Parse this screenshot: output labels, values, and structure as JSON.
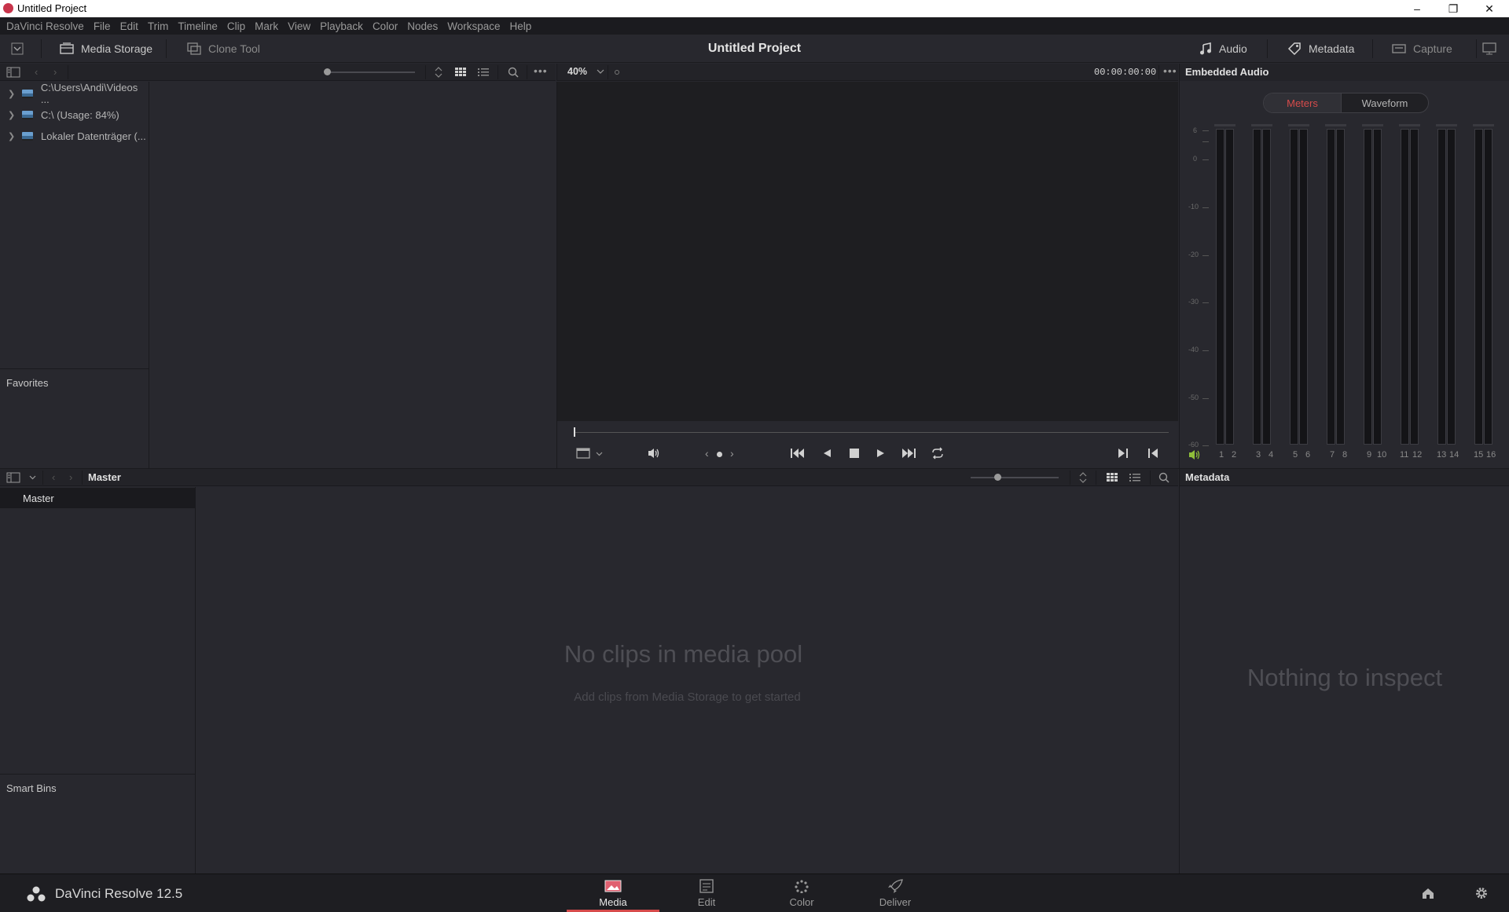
{
  "window": {
    "title": "Untitled Project"
  },
  "menu": [
    "DaVinci Resolve",
    "File",
    "Edit",
    "Trim",
    "Timeline",
    "Clip",
    "Mark",
    "View",
    "Playback",
    "Color",
    "Nodes",
    "Workspace",
    "Help"
  ],
  "toolbar": {
    "media_storage": "Media Storage",
    "clone_tool": "Clone Tool",
    "project_title": "Untitled Project",
    "audio": "Audio",
    "metadata": "Metadata",
    "capture": "Capture"
  },
  "media_storage": {
    "locations": [
      "C:\\Users\\Andi\\Videos ...",
      "C:\\ (Usage: 84%)",
      "Lokaler Datenträger (..."
    ],
    "favorites_label": "Favorites"
  },
  "viewer": {
    "zoom": "40%",
    "timecode": "00:00:00:00"
  },
  "audio_panel": {
    "title": "Embedded Audio",
    "tabs": [
      "Meters",
      "Waveform"
    ],
    "active_tab": "Meters",
    "scale": [
      "6",
      "0",
      "-10",
      "-20",
      "-30",
      "-40",
      "-50",
      "-60"
    ],
    "channel_labels": [
      "1",
      "2",
      "3",
      "4",
      "5",
      "6",
      "7",
      "8",
      "9",
      "10",
      "11",
      "12",
      "13",
      "14",
      "15",
      "16"
    ]
  },
  "media_pool": {
    "breadcrumb": "Master",
    "bins": [
      "Master"
    ],
    "smart_bins_label": "Smart Bins",
    "empty_title": "No clips in media pool",
    "empty_hint": "Add clips from Media Storage to get started"
  },
  "metadata_panel": {
    "title": "Metadata",
    "empty": "Nothing to inspect"
  },
  "footer": {
    "app_name": "DaVinci Resolve 12.5",
    "pages": [
      "Media",
      "Edit",
      "Color",
      "Deliver"
    ],
    "active_page": "Media"
  },
  "colors": {
    "accent_red": "#d64b4b",
    "panel_bg": "#28282e",
    "dark_bg": "#1b1b1f"
  }
}
